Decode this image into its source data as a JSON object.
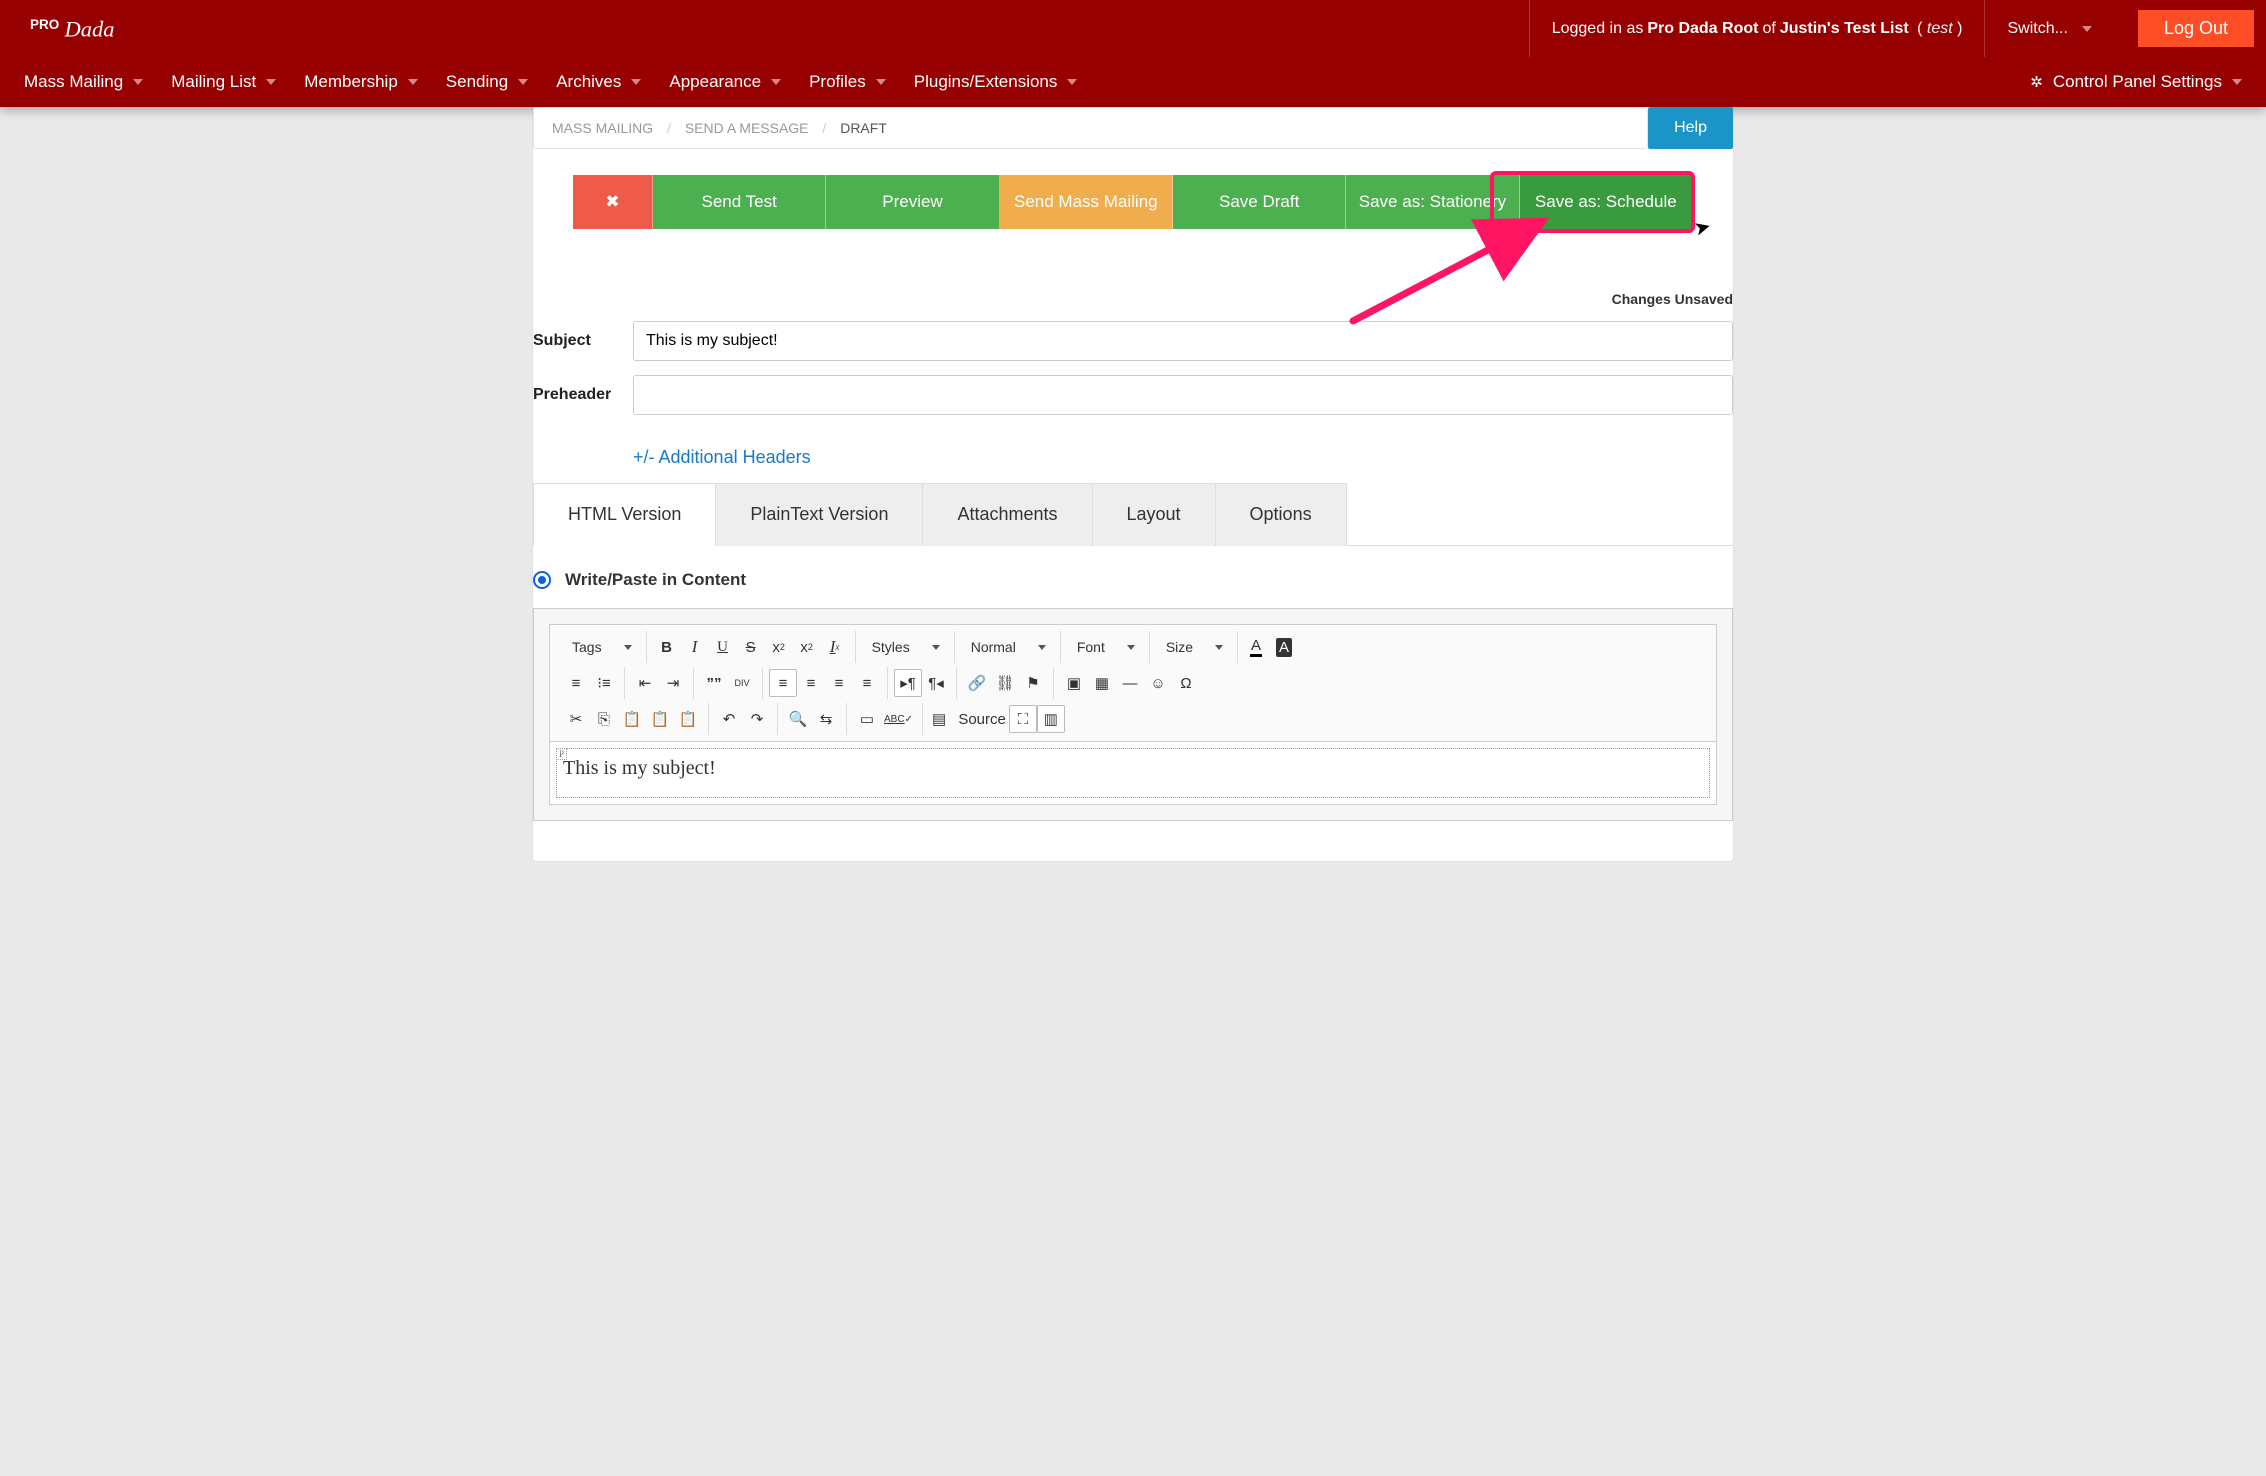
{
  "header": {
    "logged_in_prefix": "Logged in as ",
    "user": "Pro Dada Root",
    "of": " of ",
    "list_name": "Justin's Test List",
    "list_short": "test",
    "switch_label": "Switch...",
    "logout_label": "Log Out"
  },
  "nav": {
    "items": [
      {
        "label": "Mass Mailing"
      },
      {
        "label": "Mailing List"
      },
      {
        "label": "Membership"
      },
      {
        "label": "Sending"
      },
      {
        "label": "Archives"
      },
      {
        "label": "Appearance"
      },
      {
        "label": "Profiles"
      },
      {
        "label": "Plugins/Extensions"
      }
    ],
    "control_panel": "Control Panel Settings"
  },
  "breadcrumb": {
    "items": [
      "MASS MAILING",
      "SEND A MESSAGE",
      "DRAFT"
    ]
  },
  "help_label": "Help",
  "actions": {
    "close_glyph": "✖",
    "send_test": "Send Test",
    "preview": "Preview",
    "send_mass": "Send Mass Mailing",
    "save_draft": "Save Draft",
    "save_stationery": "Save as: Stationery",
    "save_schedule": "Save as: Schedule"
  },
  "status": "Changes Unsaved",
  "form": {
    "subject_label": "Subject",
    "subject_value": "This is my subject!",
    "preheader_label": "Preheader",
    "preheader_value": "",
    "additional_headers": "+/- Additional Headers"
  },
  "tabs": [
    {
      "label": "HTML Version",
      "active": true
    },
    {
      "label": "PlainText Version",
      "active": false
    },
    {
      "label": "Attachments",
      "active": false
    },
    {
      "label": "Layout",
      "active": false
    },
    {
      "label": "Options",
      "active": false
    }
  ],
  "radio_label": "Write/Paste in Content",
  "toolbar": {
    "tags": "Tags",
    "styles": "Styles",
    "format": "Normal",
    "font": "Font",
    "size": "Size",
    "div": "DIV",
    "source": "Source"
  },
  "editor_body": "This is my subject!",
  "p_badge": "P"
}
